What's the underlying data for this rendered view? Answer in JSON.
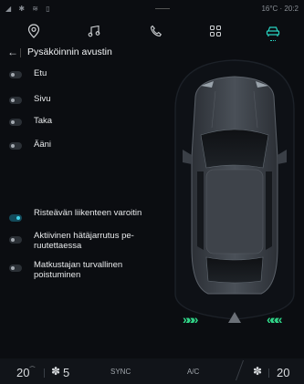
{
  "status": {
    "left": "◢ ✱ ≋ ▯",
    "right": "16°C · 20:2"
  },
  "nav": {
    "icons": [
      "location-pin-icon",
      "music-icon",
      "phone-icon",
      "apps-grid-icon",
      "car-icon"
    ],
    "active": "car-icon"
  },
  "header": {
    "back": "←",
    "title": "Pysäköinnin avustin"
  },
  "options": [
    {
      "label": "Etu",
      "on": false
    },
    {
      "label": "Sivu",
      "on": false
    },
    {
      "label": "Taka",
      "on": false
    },
    {
      "label": "Ääni",
      "on": false
    },
    {
      "label": "Risteävän liikenteen varoitin",
      "on": true
    },
    {
      "label": "Aktiivinen hätäjarrutus pe-\nruutettaessa",
      "on": false
    },
    {
      "label": "Matkustajan turvallinen\npoistuminen",
      "on": false
    }
  ],
  "panel": {
    "left_arrows": "»»»",
    "right_arrows": "«««",
    "accent": "#31d88a"
  },
  "bottom": {
    "temp_left": "20",
    "fan": "5",
    "sync": "SYNC",
    "ac": "A/C",
    "temp_right": "20"
  },
  "colors": {
    "accent": "#28d3c1",
    "toggle_on": "#3fd4ea",
    "background": "#0b0d11"
  }
}
